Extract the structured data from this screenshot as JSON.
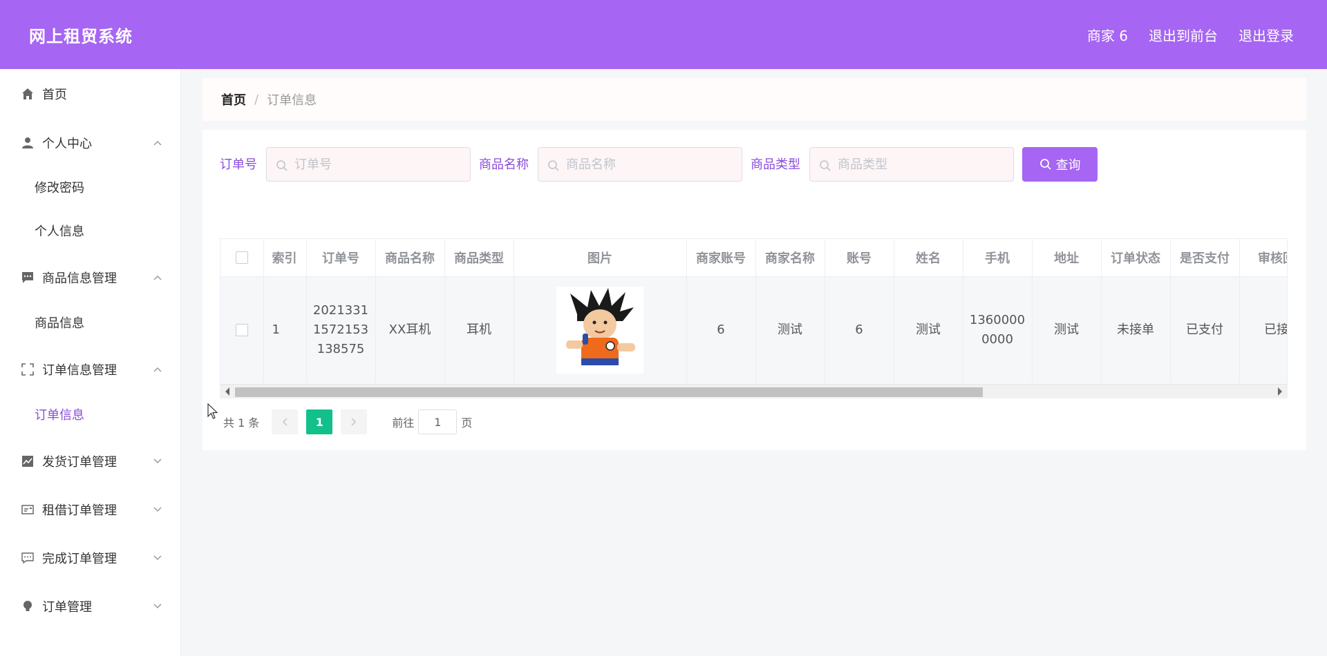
{
  "header": {
    "brand": "网上租贸系统",
    "links": [
      "商家 6",
      "退出到前台",
      "退出登录"
    ],
    "bg_color": "#a665f2"
  },
  "sidebar": {
    "home": "首页",
    "personal_center": "个人中心",
    "personal_sub": [
      "修改密码",
      "个人信息"
    ],
    "goods_mgmt": "商品信息管理",
    "goods_sub": [
      "商品信息"
    ],
    "order_info_mgmt": "订单信息管理",
    "order_info_sub": [
      "订单信息"
    ],
    "ship_mgmt": "发货订单管理",
    "rent_mgmt": "租借订单管理",
    "complete_mgmt": "完成订单管理",
    "order_mgmt": "订单管理",
    "active_color": "#8a4bdb"
  },
  "breadcrumb": {
    "home": "首页",
    "sep": "/",
    "current": "订单信息"
  },
  "filters": {
    "order_no_label": "订单号",
    "order_no_placeholder": "订单号",
    "goods_name_label": "商品名称",
    "goods_name_placeholder": "商品名称",
    "goods_type_label": "商品类型",
    "goods_type_placeholder": "商品类型",
    "query_label": "查询"
  },
  "table": {
    "columns": [
      "索引",
      "订单号",
      "商品名称",
      "商品类型",
      "图片",
      "商家账号",
      "商家名称",
      "账号",
      "姓名",
      "手机",
      "地址",
      "订单状态",
      "是否支付",
      "审核回复"
    ],
    "rows": [
      {
        "index": "1",
        "order_no": "20213311572153138575",
        "goods_name": "XX耳机",
        "goods_type": "耳机",
        "image": "goku-character-image",
        "merchant_account": "6",
        "merchant_name": "测试",
        "account": "6",
        "name": "测试",
        "phone": "13600000000",
        "address": "测试",
        "order_status": "未接单",
        "paid": "已支付",
        "review_reply": "已接单"
      }
    ]
  },
  "pagination": {
    "total_text": "共 1 条",
    "current_page": "1",
    "goto_prefix": "前往",
    "goto_value": "1",
    "goto_suffix": "页",
    "active_color": "#12c08b"
  }
}
